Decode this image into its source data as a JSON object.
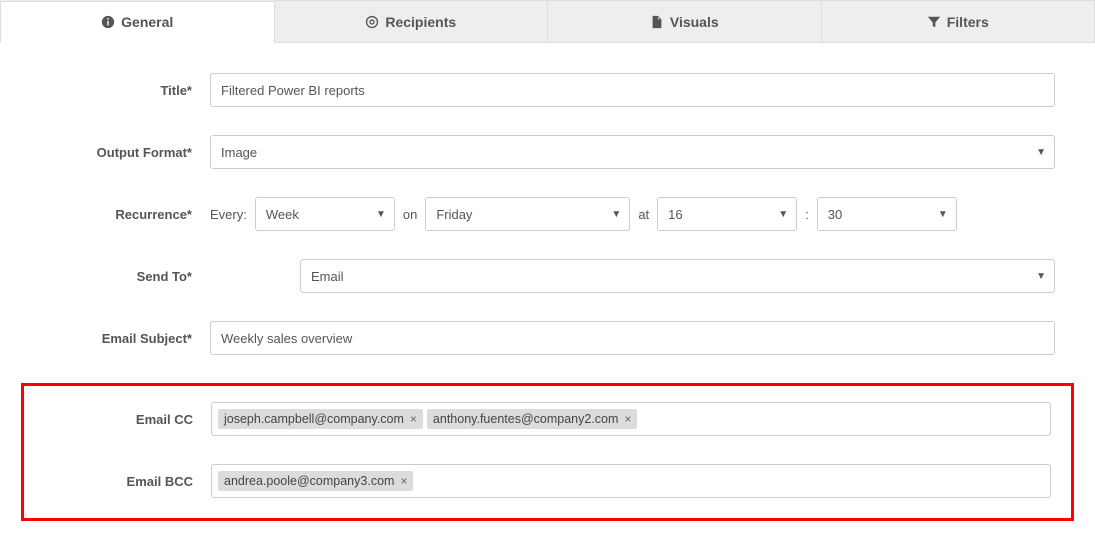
{
  "tabs": {
    "general": "General",
    "recipients": "Recipients",
    "visuals": "Visuals",
    "filters": "Filters"
  },
  "labels": {
    "title": "Title*",
    "outputFormat": "Output Format*",
    "recurrence": "Recurrence*",
    "sendTo": "Send To*",
    "emailSubject": "Email Subject*",
    "emailCC": "Email CC",
    "emailBCC": "Email BCC"
  },
  "values": {
    "title": "Filtered Power BI reports",
    "outputFormat": "Image",
    "recurrence": {
      "everyLabel": "Every:",
      "unit": "Week",
      "onLabel": "on",
      "day": "Friday",
      "atLabel": "at",
      "hour": "16",
      "sep": ":",
      "minute": "30"
    },
    "sendTo": "Email",
    "emailSubject": "Weekly sales overview",
    "emailCC": [
      "joseph.campbell@company.com",
      "anthony.fuentes@company2.com"
    ],
    "emailBCC": [
      "andrea.poole@company3.com"
    ]
  }
}
